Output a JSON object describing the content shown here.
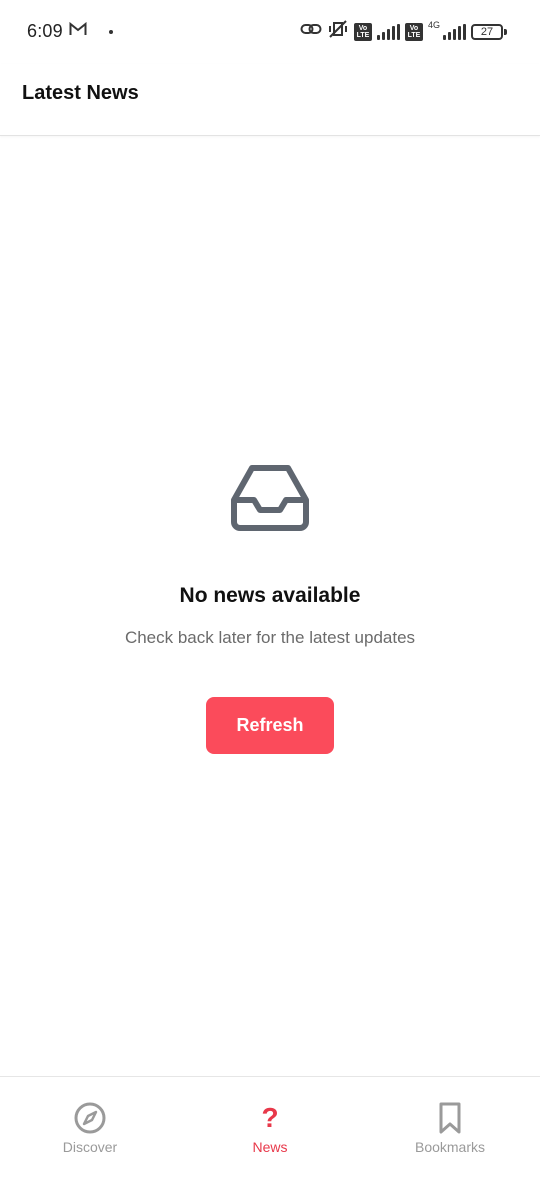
{
  "status_bar": {
    "time": "6:09",
    "network_type": "4G",
    "volte_label": "Vo\nLTE",
    "battery": "27"
  },
  "header": {
    "title": "Latest News"
  },
  "empty_state": {
    "icon": "inbox-icon",
    "title": "No news available",
    "subtitle": "Check back later for the latest updates",
    "refresh_label": "Refresh"
  },
  "bottom_nav": {
    "items": [
      {
        "label": "Discover",
        "icon": "compass-icon",
        "active": false
      },
      {
        "label": "News",
        "icon": "question-icon",
        "active": true
      },
      {
        "label": "Bookmarks",
        "icon": "bookmark-icon",
        "active": false
      }
    ]
  },
  "colors": {
    "accent": "#e8384a",
    "button": "#fb4b5b",
    "inactive": "#9a9a9a",
    "icon": "#5f6670"
  }
}
